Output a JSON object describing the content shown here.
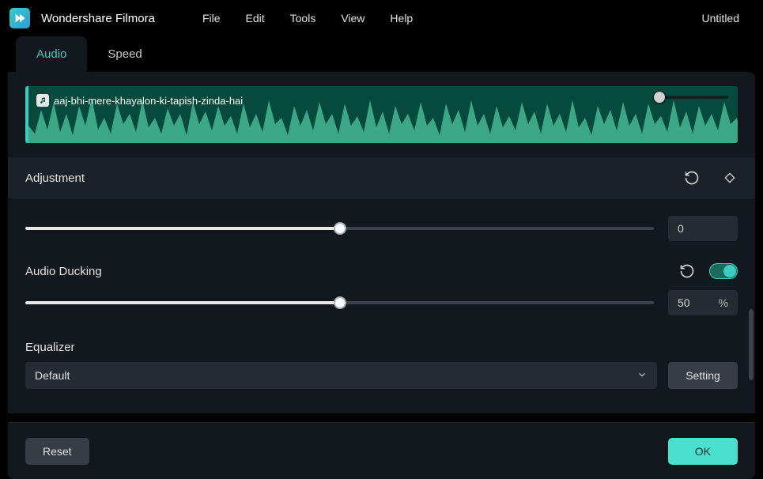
{
  "app": {
    "title": "Wondershare Filmora",
    "document": "Untitled"
  },
  "menu": [
    "File",
    "Edit",
    "Tools",
    "View",
    "Help"
  ],
  "tabs": {
    "audio": "Audio",
    "speed": "Speed"
  },
  "clip": {
    "name": "aaj-bhi-mere-khayalon-ki-tapish-zinda-hai"
  },
  "adjustment": {
    "title": "Adjustment",
    "pitch_value": "0"
  },
  "ducking": {
    "title": "Audio Ducking",
    "value": "50",
    "unit": "%",
    "enabled": true
  },
  "equalizer": {
    "title": "Equalizer",
    "selected": "Default",
    "setting_label": "Setting"
  },
  "footer": {
    "reset": "Reset",
    "ok": "OK"
  }
}
